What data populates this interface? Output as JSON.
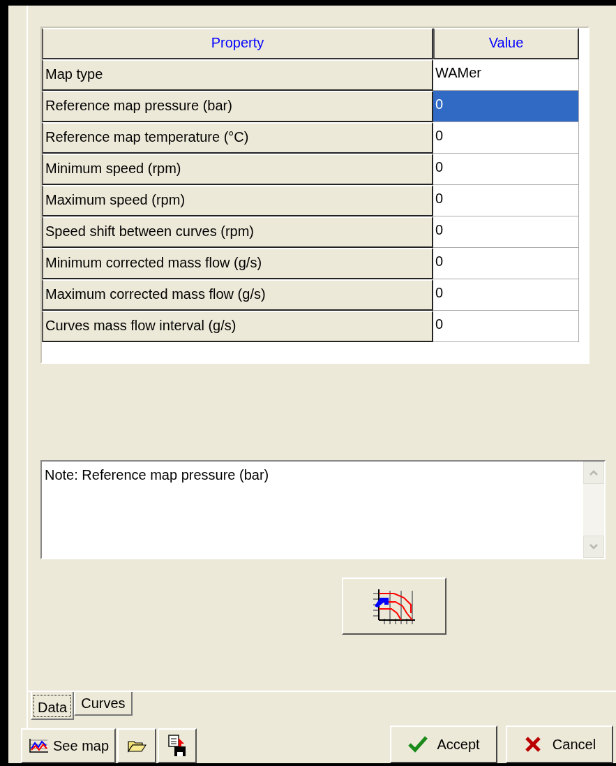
{
  "grid": {
    "columns": [
      "Property",
      "Value"
    ],
    "rows": [
      {
        "property": "Map type",
        "value": "WAMer",
        "selected": false
      },
      {
        "property": "Reference map pressure (bar)",
        "value": "0",
        "selected": true
      },
      {
        "property": "Reference map temperature (°C)",
        "value": "0",
        "selected": false
      },
      {
        "property": "Minimum speed (rpm)",
        "value": "0",
        "selected": false
      },
      {
        "property": "Maximum speed (rpm)",
        "value": "0",
        "selected": false
      },
      {
        "property": "Speed shift between curves (rpm)",
        "value": "0",
        "selected": false
      },
      {
        "property": "Minimum corrected mass flow (g/s)",
        "value": "0",
        "selected": false
      },
      {
        "property": "Maximum corrected mass flow (g/s)",
        "value": "0",
        "selected": false
      },
      {
        "property": "Curves mass flow interval (g/s)",
        "value": "0",
        "selected": false
      }
    ]
  },
  "note": "Note: Reference map pressure (bar)",
  "tabs": [
    {
      "label": "Data",
      "selected": true
    },
    {
      "label": "Curves",
      "selected": false
    }
  ],
  "toolbar": {
    "see_map": "See map"
  },
  "buttons": [
    {
      "kind": "accept",
      "label": "Accept"
    },
    {
      "kind": "cancel",
      "label": "Cancel"
    }
  ]
}
